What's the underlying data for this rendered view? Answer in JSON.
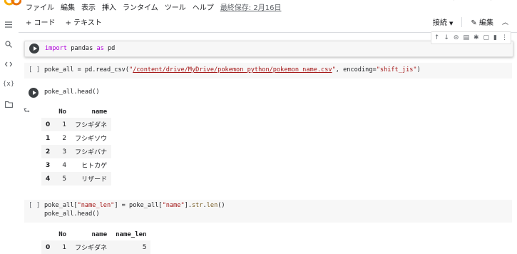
{
  "menu": [
    "ファイル",
    "編集",
    "表示",
    "挿入",
    "ランタイム",
    "ツール",
    "ヘルプ"
  ],
  "last_saved": "最終保存: 2月16日",
  "toolbar": {
    "add_code": "+ コード",
    "add_text": "+ テキスト",
    "connect": "接続",
    "edit": "編集"
  },
  "rail_icons": [
    "menu-icon",
    "search-icon",
    "code-snippets-icon",
    "variables-icon",
    "folder-icon"
  ],
  "cells": [
    {
      "bracket": "",
      "code_line": "import pandas as pd"
    },
    {
      "bracket": "[ ]",
      "code_prefix": "poke_all = pd.read_csv(\"",
      "code_path": "/content/drive/MyDrive/pokemon_python/pokemon_name.csv",
      "code_suffix": "\", encoding=\"shift_jis\")"
    },
    {
      "bracket": "",
      "code_line": "poke_all.head()"
    },
    {
      "bracket": "[ ]",
      "code_line1": "poke_all[\"name_len\"] = poke_all[\"name\"].str.len()",
      "code_line2": "poke_all.head()"
    }
  ],
  "table1": {
    "headers": [
      "",
      "No",
      "name"
    ],
    "rows": [
      [
        "0",
        "1",
        "フシギダネ"
      ],
      [
        "1",
        "2",
        "フシギソウ"
      ],
      [
        "2",
        "3",
        "フシギバナ"
      ],
      [
        "3",
        "4",
        "ヒトカゲ"
      ],
      [
        "4",
        "5",
        "リザード"
      ]
    ]
  },
  "table2": {
    "headers": [
      "",
      "No",
      "name",
      "name_len"
    ],
    "rows": [
      [
        "0",
        "1",
        "フシギダネ",
        "5"
      ]
    ]
  },
  "colors": {
    "keyword": "#af00db",
    "string": "#a31515",
    "run_button": "#3c4043"
  }
}
